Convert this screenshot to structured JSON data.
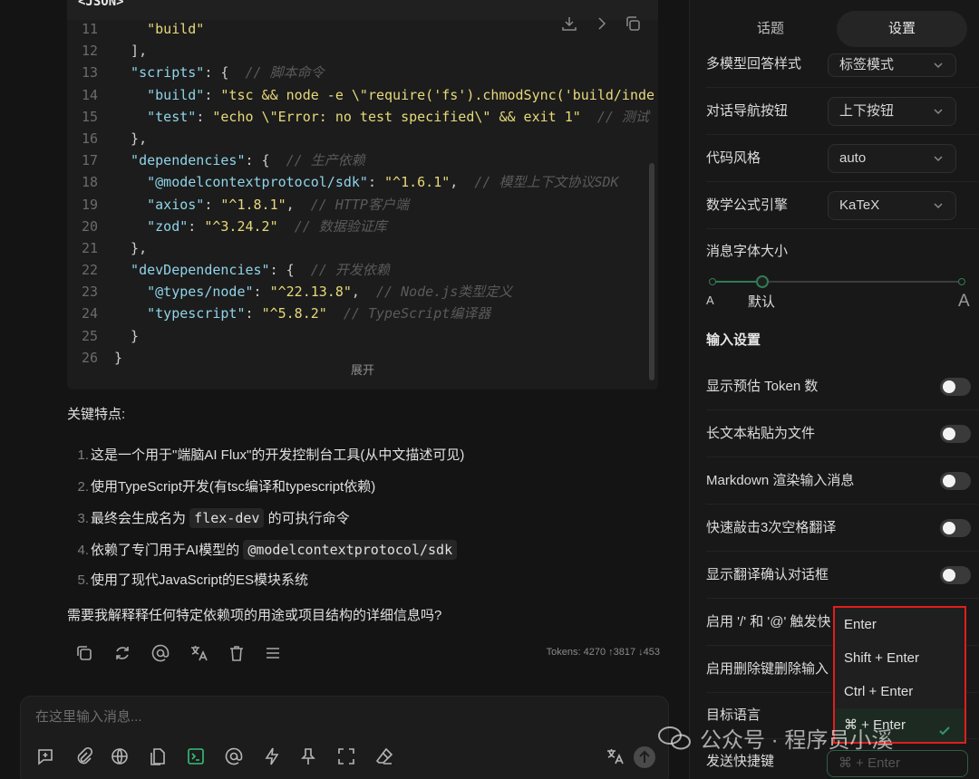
{
  "code": {
    "language": "<JSON>",
    "expand_label": "展开",
    "lines": [
      {
        "n": "11",
        "tokens": [
          {
            "t": "s",
            "v": "    \"build\""
          }
        ]
      },
      {
        "n": "12",
        "tokens": [
          {
            "t": "p",
            "v": "  ],"
          }
        ]
      },
      {
        "n": "13",
        "tokens": [
          {
            "t": "k",
            "v": "  \"scripts\""
          },
          {
            "t": "p",
            "v": ": {  "
          },
          {
            "t": "c",
            "v": "// 脚本命令"
          }
        ]
      },
      {
        "n": "14",
        "tokens": [
          {
            "t": "k",
            "v": "    \"build\""
          },
          {
            "t": "p",
            "v": ": "
          },
          {
            "t": "s",
            "v": "\"tsc && node -e \\\"require('fs').chmodSync('build/inde"
          }
        ]
      },
      {
        "n": "15",
        "tokens": [
          {
            "t": "k",
            "v": "    \"test\""
          },
          {
            "t": "p",
            "v": ": "
          },
          {
            "t": "s",
            "v": "\"echo \\\"Error: no test specified\\\" && exit 1\""
          },
          {
            "t": "p",
            "v": "  "
          },
          {
            "t": "c",
            "v": "// 测试"
          }
        ]
      },
      {
        "n": "16",
        "tokens": [
          {
            "t": "p",
            "v": "  },"
          }
        ]
      },
      {
        "n": "17",
        "tokens": [
          {
            "t": "k",
            "v": "  \"dependencies\""
          },
          {
            "t": "p",
            "v": ": {  "
          },
          {
            "t": "c",
            "v": "// 生产依赖"
          }
        ]
      },
      {
        "n": "18",
        "tokens": [
          {
            "t": "k",
            "v": "    \"@modelcontextprotocol/sdk\""
          },
          {
            "t": "p",
            "v": ": "
          },
          {
            "t": "s",
            "v": "\"^1.6.1\""
          },
          {
            "t": "p",
            "v": ",  "
          },
          {
            "t": "c",
            "v": "// 模型上下文协议SDK"
          }
        ]
      },
      {
        "n": "19",
        "tokens": [
          {
            "t": "k",
            "v": "    \"axios\""
          },
          {
            "t": "p",
            "v": ": "
          },
          {
            "t": "s",
            "v": "\"^1.8.1\""
          },
          {
            "t": "p",
            "v": ",  "
          },
          {
            "t": "c",
            "v": "// HTTP客户端"
          }
        ]
      },
      {
        "n": "20",
        "tokens": [
          {
            "t": "k",
            "v": "    \"zod\""
          },
          {
            "t": "p",
            "v": ": "
          },
          {
            "t": "s",
            "v": "\"^3.24.2\""
          },
          {
            "t": "p",
            "v": "  "
          },
          {
            "t": "c",
            "v": "// 数据验证库"
          }
        ]
      },
      {
        "n": "21",
        "tokens": [
          {
            "t": "p",
            "v": "  },"
          }
        ]
      },
      {
        "n": "22",
        "tokens": [
          {
            "t": "k",
            "v": "  \"devDependencies\""
          },
          {
            "t": "p",
            "v": ": {  "
          },
          {
            "t": "c",
            "v": "// 开发依赖"
          }
        ]
      },
      {
        "n": "23",
        "tokens": [
          {
            "t": "k",
            "v": "    \"@types/node\""
          },
          {
            "t": "p",
            "v": ": "
          },
          {
            "t": "s",
            "v": "\"^22.13.8\""
          },
          {
            "t": "p",
            "v": ",  "
          },
          {
            "t": "c",
            "v": "// Node.js类型定义"
          }
        ]
      },
      {
        "n": "24",
        "tokens": [
          {
            "t": "k",
            "v": "    \"typescript\""
          },
          {
            "t": "p",
            "v": ": "
          },
          {
            "t": "s",
            "v": "\"^5.8.2\""
          },
          {
            "t": "p",
            "v": "  "
          },
          {
            "t": "c",
            "v": "// TypeScript编译器"
          }
        ]
      },
      {
        "n": "25",
        "tokens": [
          {
            "t": "p",
            "v": "  }"
          }
        ]
      },
      {
        "n": "26",
        "tokens": [
          {
            "t": "p",
            "v": "}"
          }
        ]
      }
    ]
  },
  "answer": {
    "title": "关键特点:",
    "items": [
      {
        "num": "1.",
        "parts": [
          {
            "t": "text",
            "v": "这是一个用于\"端脑AI Flux\"的开发控制台工具(从中文描述可见)"
          }
        ]
      },
      {
        "num": "2.",
        "parts": [
          {
            "t": "text",
            "v": "使用TypeScript开发(有tsc编译和typescript依赖)"
          }
        ]
      },
      {
        "num": "3.",
        "parts": [
          {
            "t": "text",
            "v": "最终会生成名为 "
          },
          {
            "t": "code",
            "v": "flex-dev"
          },
          {
            "t": "text",
            "v": " 的可执行命令"
          }
        ]
      },
      {
        "num": "4.",
        "parts": [
          {
            "t": "text",
            "v": "依赖了专门用于AI模型的 "
          },
          {
            "t": "code",
            "v": "@modelcontextprotocol/sdk"
          }
        ]
      },
      {
        "num": "5.",
        "parts": [
          {
            "t": "text",
            "v": "使用了现代JavaScript的ES模块系统"
          }
        ]
      }
    ],
    "followup": "需要我解释释任何特定依赖项的用途或项目结构的详细信息吗?"
  },
  "message_actions": {
    "icons": [
      "copy-icon",
      "regenerate-icon",
      "mention-icon",
      "translate-icon",
      "delete-icon",
      "menu-icon"
    ],
    "tokens": "Tokens: 4270 ↑3817 ↓453"
  },
  "composer": {
    "placeholder": "在这里输入消息...",
    "tools": [
      "new-topic-icon",
      "attachment-icon",
      "web-search-icon",
      "knowledge-icon",
      "terminal-icon",
      "mention-icon",
      "quick-phrase-icon",
      "pin-icon",
      "fullscreen-icon",
      "clear-icon"
    ]
  },
  "panel": {
    "tabs": [
      {
        "label": "话题",
        "active": false
      },
      {
        "label": "设置",
        "active": true
      }
    ],
    "select_rows": [
      {
        "label": "多模型回答样式",
        "value": "标签模式"
      },
      {
        "label": "对话导航按钮",
        "value": "上下按钮"
      },
      {
        "label": "代码风格",
        "value": "auto"
      },
      {
        "label": "数学公式引擎",
        "value": "KaTeX"
      }
    ],
    "font_size": {
      "label": "消息字体大小",
      "small": "A",
      "default": "默认",
      "large": "A",
      "level": 0.2
    },
    "section_input": "输入设置",
    "toggle_rows": [
      {
        "label": "显示预估 Token 数",
        "on": false
      },
      {
        "label": "长文本粘贴为文件",
        "on": false
      },
      {
        "label": "Markdown 渲染输入消息",
        "on": false
      },
      {
        "label": "快速敲击3次空格翻译",
        "on": false
      },
      {
        "label": "显示翻译确认对话框",
        "on": false
      }
    ],
    "other_rows": [
      {
        "label": "启用 '/' 和 '@' 触发快"
      },
      {
        "label": "启用删除键删除输入"
      },
      {
        "label": "目标语言"
      },
      {
        "label": "发送快捷键"
      }
    ],
    "send_shortcut": {
      "value": "⌘ + Enter",
      "options": [
        {
          "label": "Enter",
          "selected": false
        },
        {
          "label": "Shift + Enter",
          "selected": false
        },
        {
          "label": "Ctrl + Enter",
          "selected": false
        },
        {
          "label": "⌘ + Enter",
          "selected": true
        }
      ],
      "highlight_color": "#e01e1e"
    }
  },
  "watermark": "公众号 · 程序员小溪"
}
